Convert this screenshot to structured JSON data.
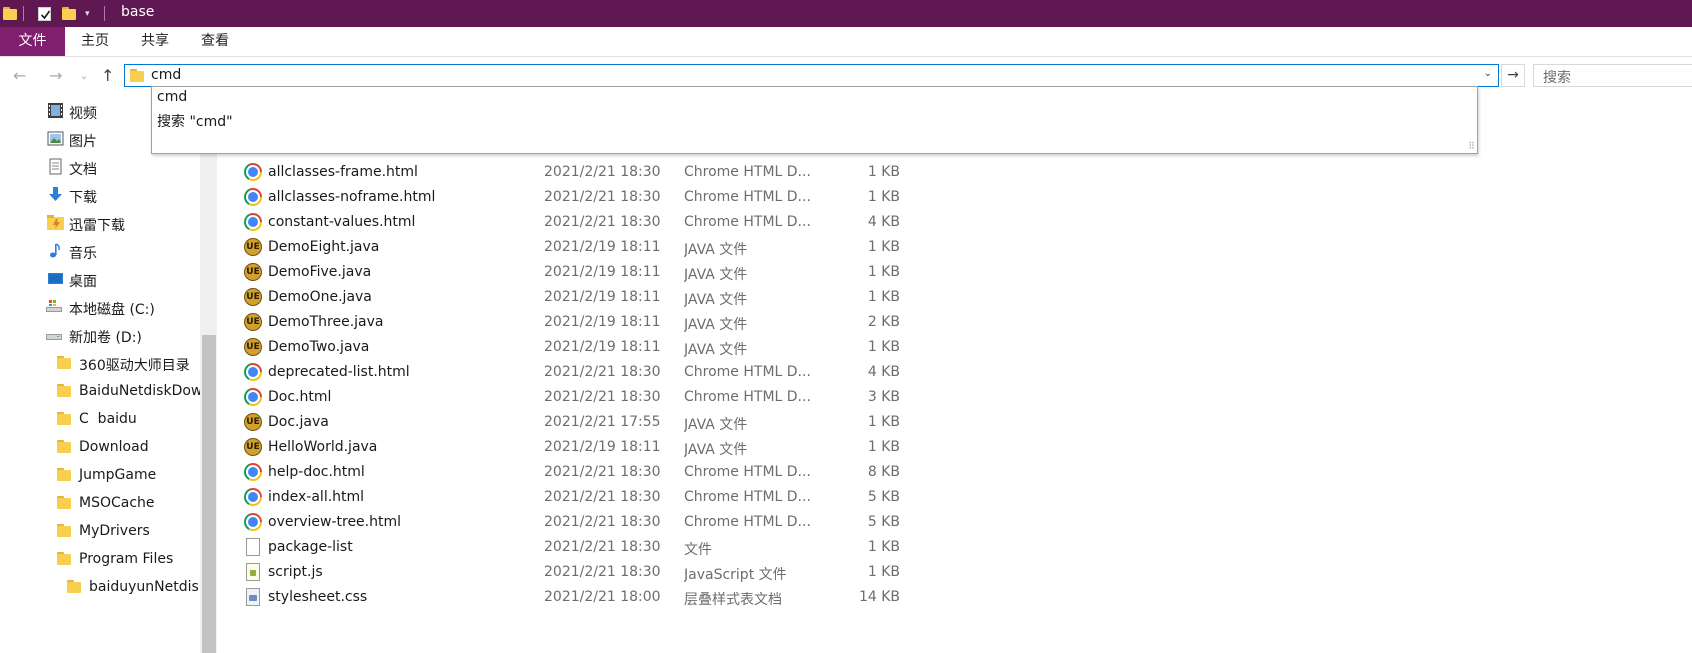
{
  "window": {
    "title": "base"
  },
  "ribbon": {
    "tabs": [
      "文件",
      "主页",
      "共享",
      "查看"
    ]
  },
  "address": {
    "value": "cmd",
    "search_placeholder": "搜索"
  },
  "autocomplete": {
    "items": [
      "cmd",
      "搜索 \"cmd\""
    ]
  },
  "navigation": {
    "items": [
      {
        "label": "视频",
        "icon": "video-icon"
      },
      {
        "label": "图片",
        "icon": "pictures-icon"
      },
      {
        "label": "文档",
        "icon": "documents-icon"
      },
      {
        "label": "下载",
        "icon": "downloads-icon"
      },
      {
        "label": "迅雷下载",
        "icon": "thunder-folder-icon"
      },
      {
        "label": "音乐",
        "icon": "music-icon"
      },
      {
        "label": "桌面",
        "icon": "desktop-icon"
      },
      {
        "label": "本地磁盘 (C:)",
        "icon": "drive-icon"
      },
      {
        "label": "新加卷 (D:)",
        "icon": "drive-icon"
      },
      {
        "label": "360驱动大师目录",
        "icon": "folder-icon"
      },
      {
        "label": "BaiduNetdiskDow",
        "icon": "folder-icon"
      },
      {
        "label": "C  baidu",
        "icon": "folder-icon"
      },
      {
        "label": "Download",
        "icon": "folder-icon"
      },
      {
        "label": "JumpGame",
        "icon": "folder-icon"
      },
      {
        "label": "MSOCache",
        "icon": "folder-icon"
      },
      {
        "label": "MyDrivers",
        "icon": "folder-icon"
      },
      {
        "label": "Program Files",
        "icon": "folder-icon"
      },
      {
        "label": "baiduyunNetdisk",
        "icon": "folder-icon"
      }
    ]
  },
  "files": [
    {
      "name": "allclasses-frame.html",
      "date": "2021/2/21 18:30",
      "type": "Chrome HTML D...",
      "size": "1 KB",
      "icon": "chrome-html-icon"
    },
    {
      "name": "allclasses-noframe.html",
      "date": "2021/2/21 18:30",
      "type": "Chrome HTML D...",
      "size": "1 KB",
      "icon": "chrome-html-icon"
    },
    {
      "name": "constant-values.html",
      "date": "2021/2/21 18:30",
      "type": "Chrome HTML D...",
      "size": "4 KB",
      "icon": "chrome-html-icon"
    },
    {
      "name": "DemoEight.java",
      "date": "2021/2/19 18:11",
      "type": "JAVA 文件",
      "size": "1 KB",
      "icon": "java-file-icon"
    },
    {
      "name": "DemoFive.java",
      "date": "2021/2/19 18:11",
      "type": "JAVA 文件",
      "size": "1 KB",
      "icon": "java-file-icon"
    },
    {
      "name": "DemoOne.java",
      "date": "2021/2/19 18:11",
      "type": "JAVA 文件",
      "size": "1 KB",
      "icon": "java-file-icon"
    },
    {
      "name": "DemoThree.java",
      "date": "2021/2/19 18:11",
      "type": "JAVA 文件",
      "size": "2 KB",
      "icon": "java-file-icon"
    },
    {
      "name": "DemoTwo.java",
      "date": "2021/2/19 18:11",
      "type": "JAVA 文件",
      "size": "1 KB",
      "icon": "java-file-icon"
    },
    {
      "name": "deprecated-list.html",
      "date": "2021/2/21 18:30",
      "type": "Chrome HTML D...",
      "size": "4 KB",
      "icon": "chrome-html-icon"
    },
    {
      "name": "Doc.html",
      "date": "2021/2/21 18:30",
      "type": "Chrome HTML D...",
      "size": "3 KB",
      "icon": "chrome-html-icon"
    },
    {
      "name": "Doc.java",
      "date": "2021/2/21 17:55",
      "type": "JAVA 文件",
      "size": "1 KB",
      "icon": "java-file-icon"
    },
    {
      "name": "HelloWorld.java",
      "date": "2021/2/19 18:11",
      "type": "JAVA 文件",
      "size": "1 KB",
      "icon": "java-file-icon"
    },
    {
      "name": "help-doc.html",
      "date": "2021/2/21 18:30",
      "type": "Chrome HTML D...",
      "size": "8 KB",
      "icon": "chrome-html-icon"
    },
    {
      "name": "index-all.html",
      "date": "2021/2/21 18:30",
      "type": "Chrome HTML D...",
      "size": "5 KB",
      "icon": "chrome-html-icon"
    },
    {
      "name": "overview-tree.html",
      "date": "2021/2/21 18:30",
      "type": "Chrome HTML D...",
      "size": "5 KB",
      "icon": "chrome-html-icon"
    },
    {
      "name": "package-list",
      "date": "2021/2/21 18:30",
      "type": "文件",
      "size": "1 KB",
      "icon": "generic-file-icon"
    },
    {
      "name": "script.js",
      "date": "2021/2/21 18:30",
      "type": "JavaScript 文件",
      "size": "1 KB",
      "icon": "javascript-file-icon"
    },
    {
      "name": "stylesheet.css",
      "date": "2021/2/21 18:00",
      "type": "层叠样式表文档",
      "size": "14 KB",
      "icon": "css-file-icon"
    }
  ],
  "colors": {
    "titlebar": "#5f1852",
    "file_tab": "#7f1f6d",
    "accent": "#0078d7",
    "folder": "#f8cf4e"
  }
}
